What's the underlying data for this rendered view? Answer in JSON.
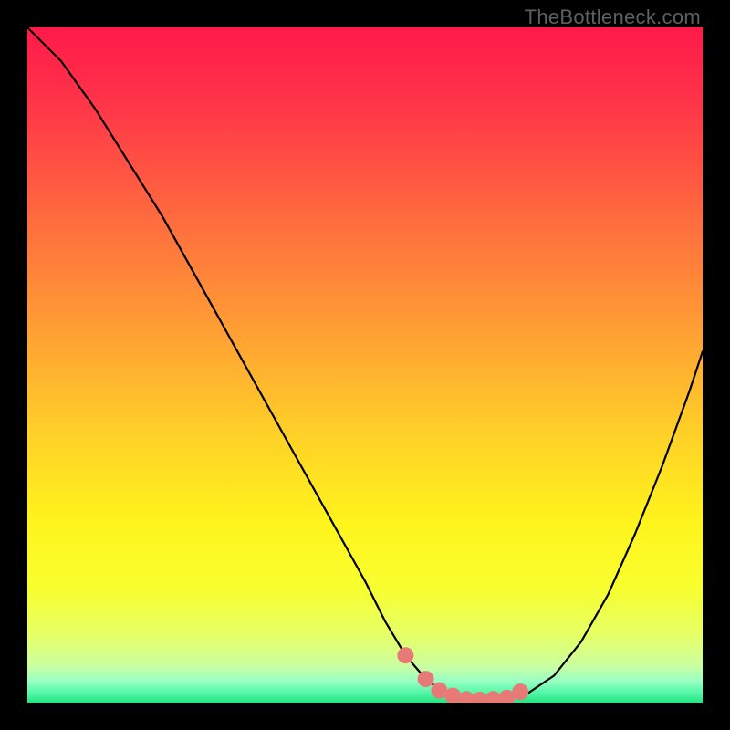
{
  "watermark": {
    "text": "TheBottleneck.com"
  },
  "colors": {
    "black": "#000000",
    "curve": "#000000",
    "marker": "#e77a76",
    "gradient_stops": [
      {
        "offset": 0.0,
        "color": "#ff1a4a"
      },
      {
        "offset": 0.1,
        "color": "#ff3149"
      },
      {
        "offset": 0.22,
        "color": "#ff5742"
      },
      {
        "offset": 0.35,
        "color": "#ff803a"
      },
      {
        "offset": 0.48,
        "color": "#ffa932"
      },
      {
        "offset": 0.6,
        "color": "#ffd028"
      },
      {
        "offset": 0.73,
        "color": "#fff31c"
      },
      {
        "offset": 0.83,
        "color": "#f8ff2f"
      },
      {
        "offset": 0.9,
        "color": "#e6ff66"
      },
      {
        "offset": 0.945,
        "color": "#ccffa0"
      },
      {
        "offset": 0.968,
        "color": "#99ffc4"
      },
      {
        "offset": 0.985,
        "color": "#55f7a8"
      },
      {
        "offset": 1.0,
        "color": "#24e37f"
      }
    ]
  },
  "chart_data": {
    "type": "line",
    "title": "",
    "xlabel": "",
    "ylabel": "",
    "xlim": [
      0,
      100
    ],
    "ylim": [
      0,
      100
    ],
    "series": [
      {
        "name": "bottleneck-curve",
        "x": [
          0,
          5,
          10,
          15,
          20,
          25,
          30,
          35,
          40,
          45,
          50,
          53,
          56,
          59,
          62,
          65,
          68,
          71,
          74,
          78,
          82,
          86,
          90,
          94,
          98,
          100
        ],
        "y": [
          100,
          95,
          88,
          80,
          72,
          63,
          54,
          45,
          36,
          27,
          18,
          12,
          7,
          3.5,
          1.2,
          0.5,
          0.4,
          0.5,
          1.3,
          4,
          9,
          16,
          25,
          35,
          46,
          52
        ]
      }
    ],
    "markers": {
      "name": "highlight-points",
      "x": [
        56,
        59,
        61,
        63,
        65,
        67,
        69,
        71,
        73
      ],
      "y": [
        7.0,
        3.5,
        1.8,
        1.0,
        0.5,
        0.4,
        0.5,
        0.7,
        1.6
      ]
    }
  }
}
